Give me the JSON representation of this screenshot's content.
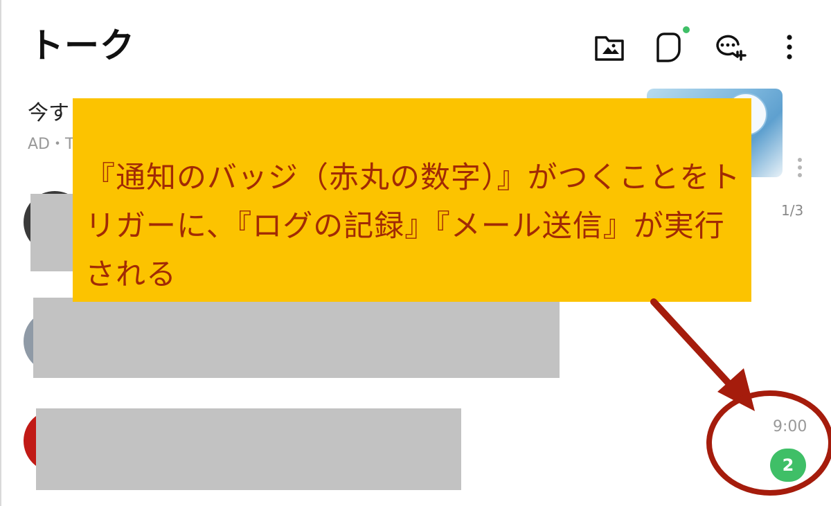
{
  "header": {
    "title": "トーク",
    "icons": [
      "album-folder-icon",
      "story-icon",
      "new-chat-icon",
      "more-vertical-icon"
    ],
    "story_dot_color": "#3fbf67"
  },
  "ad": {
    "title_visible": "今す",
    "sub_visible": "AD・T",
    "more_icon": "more-vertical-icon",
    "page_indicator": "1/3"
  },
  "chat_list": [
    {
      "name": "",
      "preview": "",
      "time": "",
      "unread": ""
    },
    {
      "name": "",
      "preview": "",
      "time": "",
      "unread": ""
    },
    {
      "name": "",
      "preview": "",
      "time": "9:00",
      "unread": "2"
    }
  ],
  "annotation": {
    "text": "『通知のバッジ（赤丸の数字）』がつくことをトリガーに、『ログの記録』『メール送信』が実行される",
    "box_color": "#fcc300",
    "text_color": "#a12a05",
    "arrow_color": "#a51c0c"
  },
  "colors": {
    "badge": "#3fbf67",
    "redaction": "#c2c2c2"
  }
}
